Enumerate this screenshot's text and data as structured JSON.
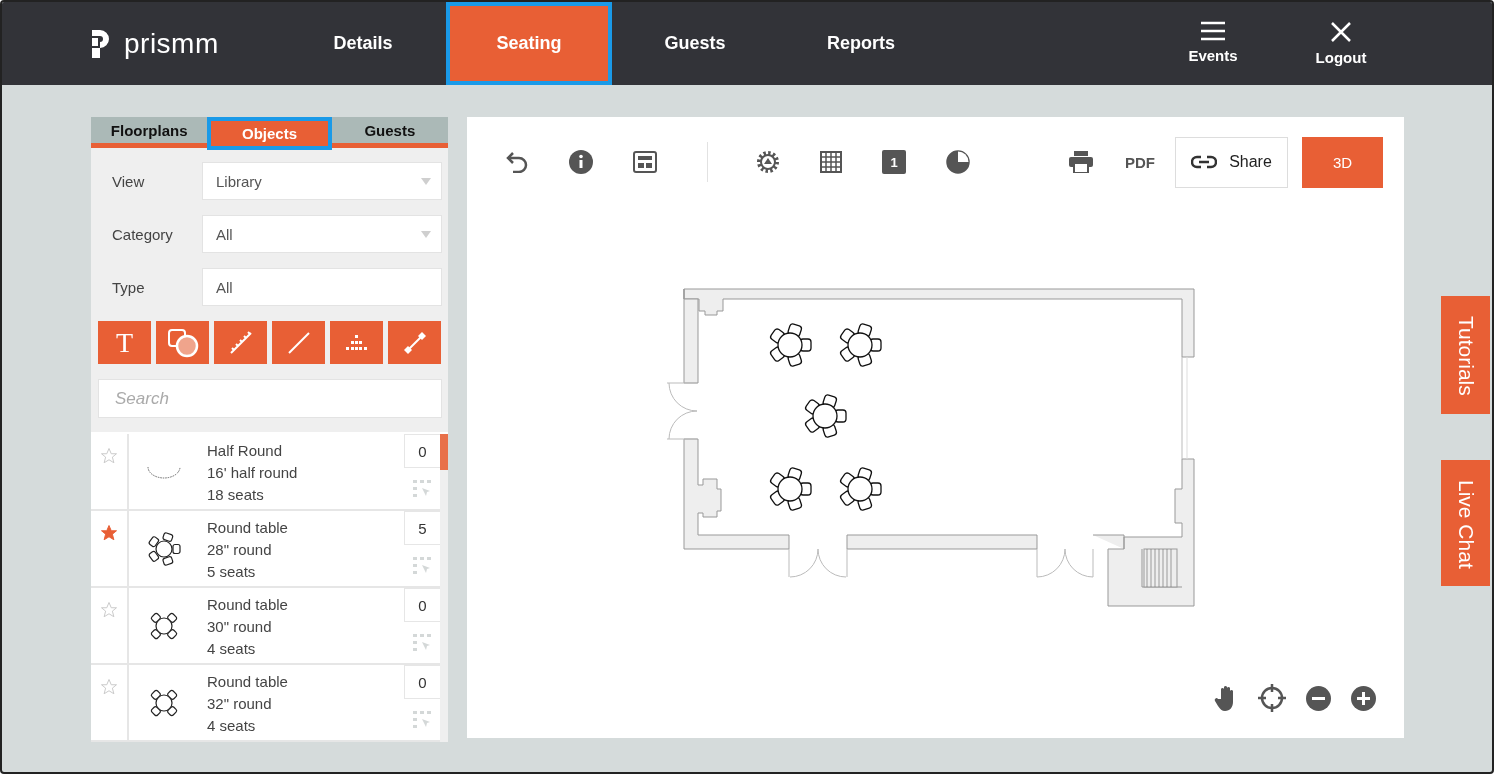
{
  "brand": "prismm",
  "nav": [
    {
      "label": "Details",
      "selected": false
    },
    {
      "label": "Seating",
      "selected": true
    },
    {
      "label": "Guests",
      "selected": false
    },
    {
      "label": "Reports",
      "selected": false
    }
  ],
  "nav_actions": [
    {
      "label": "Events",
      "kind": "menu"
    },
    {
      "label": "Logout",
      "kind": "close"
    }
  ],
  "panel_tabs": [
    {
      "label": "Floorplans",
      "selected": false
    },
    {
      "label": "Objects",
      "selected": true
    },
    {
      "label": "Guests",
      "selected": false
    }
  ],
  "filters": [
    {
      "label": "View",
      "value": "Library",
      "kind": "dropdown"
    },
    {
      "label": "Category",
      "value": "All",
      "kind": "dropdown"
    },
    {
      "label": "Type",
      "value": "All",
      "kind": "text"
    }
  ],
  "tools": [
    {
      "kind": "text",
      "label": "T"
    },
    {
      "kind": "shapes"
    },
    {
      "kind": "ruler"
    },
    {
      "kind": "line"
    },
    {
      "kind": "dots"
    },
    {
      "kind": "measure"
    }
  ],
  "search": {
    "placeholder": "Search"
  },
  "objects": [
    {
      "starred": false,
      "kind": "half-round",
      "name": "Half Round",
      "size": "16' half round",
      "seats": "18 seats",
      "count": "0"
    },
    {
      "starred": true,
      "kind": "round5",
      "name": "Round table",
      "size": "28\" round",
      "seats": "5 seats",
      "count": "5"
    },
    {
      "starred": false,
      "kind": "round4",
      "name": "Round table",
      "size": "30\" round",
      "seats": "4 seats",
      "count": "0"
    },
    {
      "starred": false,
      "kind": "round4",
      "name": "Round table",
      "size": "32\" round",
      "seats": "4 seats",
      "count": "0"
    }
  ],
  "toolbar": {
    "page_number": "1",
    "pdf": "PDF",
    "share": "Share",
    "view_3d": "3D"
  },
  "side_tabs": [
    "Tutorials",
    "Live Chat"
  ]
}
